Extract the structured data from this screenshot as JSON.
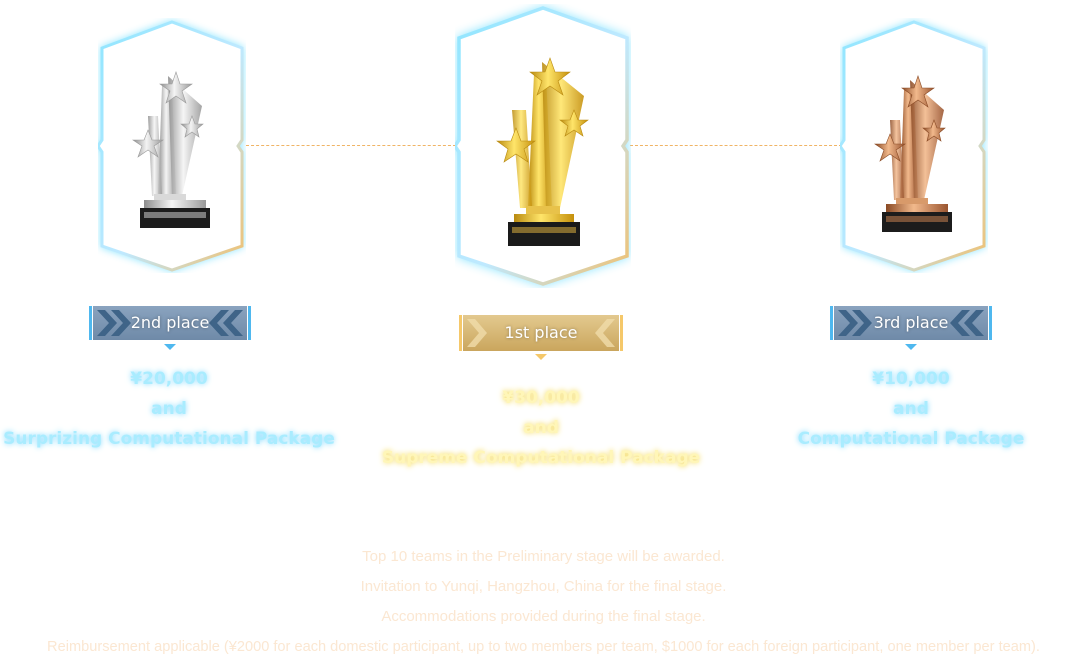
{
  "colors": {
    "cyan_glow": "#7fdcff",
    "gold_glow": "#e8b84a",
    "silver_banner": "#5b7c9e",
    "gold_banner": "#d4b372",
    "prize_cyan": "#a9ecff",
    "prize_gold": "#fff6b8",
    "notes_text": "#fbe7d2"
  },
  "awards": {
    "second": {
      "icon": "silver-trophy-icon",
      "place_label": "2nd place",
      "amount": "¥20,000",
      "conjunction": "and",
      "package": "Surprizing Computational Package"
    },
    "first": {
      "icon": "gold-trophy-icon",
      "place_label": "1st place",
      "amount": "¥30,000",
      "conjunction": "and",
      "package": "Supreme Computational Package"
    },
    "third": {
      "icon": "bronze-trophy-icon",
      "place_label": "3rd place",
      "amount": "¥10,000",
      "conjunction": "and",
      "package": "Computational Package"
    }
  },
  "notes": [
    "Top 10 teams in the Preliminary stage will be awarded.",
    "Invitation to Yunqi, Hangzhou, China for the final stage.",
    "Accommodations provided during the final stage.",
    "Reimbursement applicable (¥2000 for each domestic participant, up to two members per team, $1000 for each foreign participant, one member per team)."
  ]
}
